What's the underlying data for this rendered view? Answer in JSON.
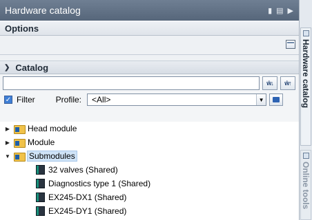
{
  "panel": {
    "title": "Hardware catalog",
    "options_header": "Options",
    "catalog_header": "Catalog"
  },
  "search": {
    "value": "",
    "placeholder": ""
  },
  "search_buttons": {
    "search_down": "ŵ↓",
    "search_up": "ŵ↑"
  },
  "filter": {
    "checked": true,
    "label": "Filter",
    "profile_label": "Profile:",
    "profile_value": "<All>"
  },
  "tree": [
    {
      "label": "Head module",
      "kind": "folder",
      "expanded": false
    },
    {
      "label": "Module",
      "kind": "folder",
      "expanded": false
    },
    {
      "label": "Submodules",
      "kind": "folder",
      "expanded": true,
      "selected": true
    },
    {
      "label": "32 valves (Shared)",
      "kind": "module"
    },
    {
      "label": "Diagnostics type 1 (Shared)",
      "kind": "module"
    },
    {
      "label": "EX245-DX1 (Shared)",
      "kind": "module"
    },
    {
      "label": "EX245-DY1 (Shared)",
      "kind": "module"
    }
  ],
  "side_tabs": {
    "hardware_catalog": "Hardware catalog",
    "online_tools": "Online tools"
  },
  "icons": {
    "titlebar": [
      "pin-icon",
      "layout-icon",
      "collapse-right-icon"
    ],
    "catalog_chevron": "chevron-down-icon",
    "folder": "folder-icon",
    "module": "module-icon"
  },
  "colors": {
    "titlebar": "#5f6f83",
    "selection": "#cfe3f7",
    "checkbox": "#3f7fd6"
  }
}
